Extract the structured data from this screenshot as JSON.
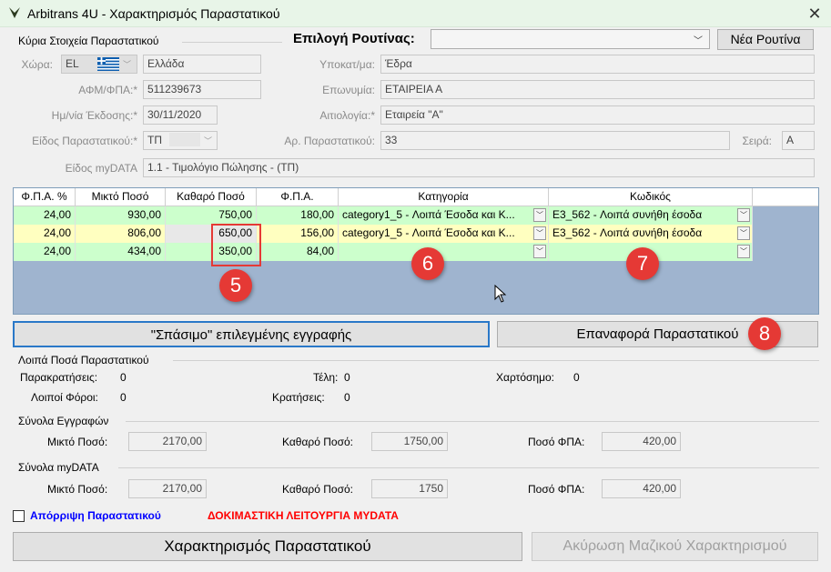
{
  "window": {
    "title": "Arbitrans 4U - Χαρακτηρισμός Παραστατικού",
    "close_glyph": "✕"
  },
  "routine": {
    "label": "Επιλογή Ρουτίνας:",
    "selected": "",
    "new_button": "Νέα Ρουτίνα"
  },
  "main_group": {
    "title": "Κύρια Στοιχεία Παραστατικού",
    "country_label": "Χώρα:",
    "country_code": "EL",
    "country_name": "Ελλάδα",
    "vat_label": "ΑΦΜ/ΦΠΑ:*",
    "vat_value": "511239673",
    "date_label": "Ημ/νία Έκδοσης:*",
    "date_value": "30/11/2020",
    "doc_type_label": "Είδος Παραστατικού:*",
    "doc_type_value": "ΤΠ",
    "mydata_type_label": "Είδος myDATA",
    "mydata_type_value": "1.1 - Τιμολόγιο Πώλησης - (ΤΠ)",
    "branch_label": "Υποκατ/μα:",
    "branch_value": "Έδρα",
    "name_label": "Επωνυμία:",
    "name_value": "ΕΤΑΙΡΕΙΑ Α",
    "reason_label": "Αιτιολογία:*",
    "reason_value": "Εταιρεία \"Α\"",
    "doc_number_label": "Αρ. Παραστατικού:",
    "doc_number_value": "33",
    "series_label": "Σειρά:",
    "series_value": "Α"
  },
  "grid": {
    "headers": [
      "Φ.Π.Α. %",
      "Μικτό Ποσό",
      "Καθαρό Ποσό",
      "Φ.Π.Α.",
      "Κατηγορία",
      "Κωδικός"
    ],
    "rows": [
      {
        "vat_pct": "24,00",
        "gross": "930,00",
        "net": "750,00",
        "vat": "180,00",
        "category": "category1_5  - Λοιπά Έσοδα και Κ...",
        "code": "E3_562 - Λοιπά συνήθη έσοδα",
        "color": "#ccffcc"
      },
      {
        "vat_pct": "24,00",
        "gross": "806,00",
        "net": "650,00",
        "vat": "156,00",
        "category": "category1_5  - Λοιπά Έσοδα και Κ...",
        "code": "E3_562 - Λοιπά συνήθη έσοδα",
        "color": "#ffffc0"
      },
      {
        "vat_pct": "24,00",
        "gross": "434,00",
        "net": "350,00",
        "vat": "84,00",
        "category": "",
        "code": "",
        "color": "#ccffcc"
      }
    ]
  },
  "markers": {
    "m5": "5",
    "m6": "6",
    "m7": "7",
    "m8": "8"
  },
  "buttons": {
    "split": "\"Σπάσιμο\" επιλεγμένης εγγραφής",
    "reset": "Επαναφορά Παραστατικού",
    "characterize": "Χαρακτηρισμός Παραστατικού",
    "cancel_bulk": "Ακύρωση Μαζικού Χαρακτηρισμού"
  },
  "other_amounts": {
    "title": "Λοιπά Ποσά Παραστατικού",
    "withholdings_label": "Παρακρατήσεις:",
    "withholdings_value": "0",
    "fees_label": "Τέλη:",
    "fees_value": "0",
    "stamp_label": "Χαρτόσημο:",
    "stamp_value": "0",
    "other_taxes_label": "Λοιποί Φόροι:",
    "other_taxes_value": "0",
    "deductions_label": "Κρατήσεις:",
    "deductions_value": "0"
  },
  "totals_records": {
    "title": "Σύνολα Εγγραφών",
    "gross_label": "Μικτό Ποσό:",
    "gross_value": "2170,00",
    "net_label": "Καθαρό Ποσό:",
    "net_value": "1750,00",
    "vat_label": "Ποσό ΦΠΑ:",
    "vat_value": "420,00"
  },
  "totals_mydata": {
    "title": "Σύνολα myDATA",
    "gross_label": "Μικτό Ποσό:",
    "gross_value": "2170,00",
    "net_label": "Καθαρό Ποσό:",
    "net_value": "1750",
    "vat_label": "Ποσό ΦΠΑ:",
    "vat_value": "420,00"
  },
  "reject": {
    "label": "Απόρριψη Παραστατικού",
    "checked": false
  },
  "test_mode": "ΔΟΚΙΜΑΣΤΙΚΗ ΛΕΙΤΟΥΡΓΙΑ MYDATA",
  "colors": {
    "accent_blue": "#0000ff",
    "warning_red": "#ff0000",
    "marker_red": "#e53935",
    "grid_bg": "#9fb4cf"
  }
}
